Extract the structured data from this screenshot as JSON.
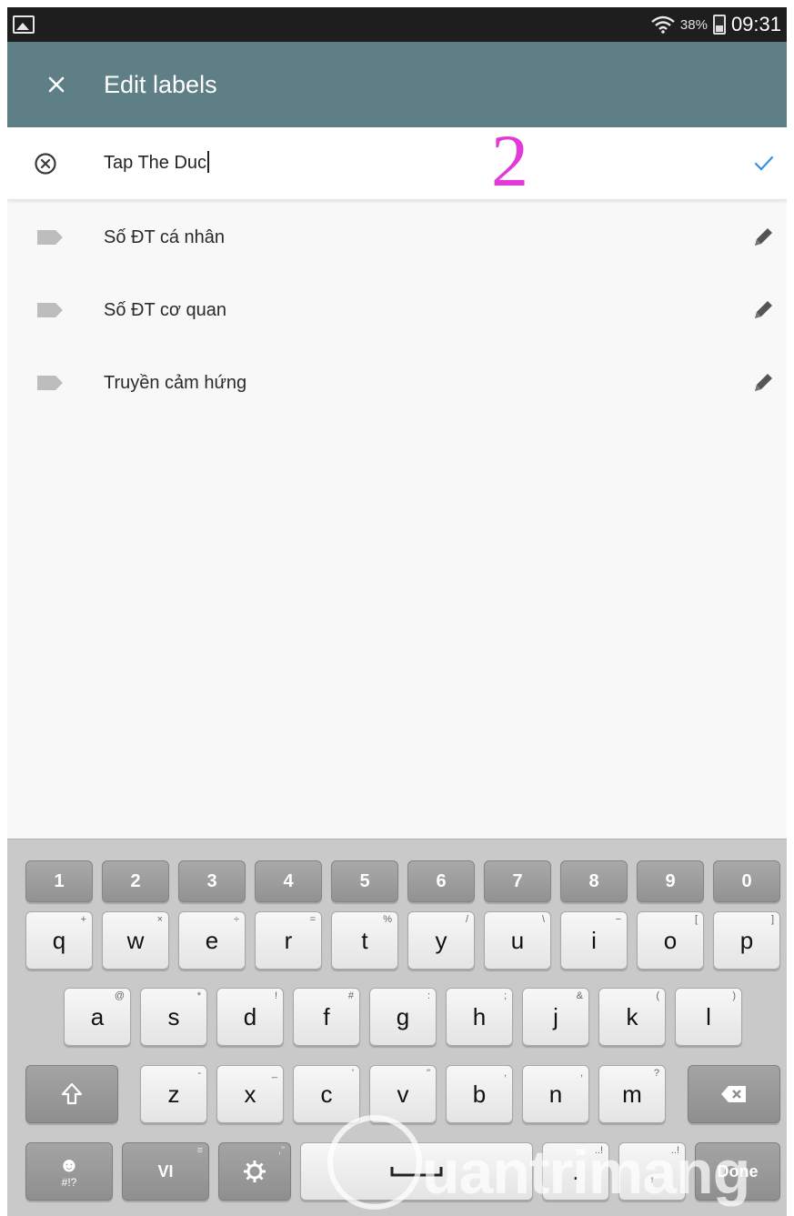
{
  "status_bar": {
    "left_icon": "gallery-icon",
    "wifi_icon": "wifi-icon",
    "battery_percent": "38%",
    "battery_icon": "battery-charging-icon",
    "time": "09:31"
  },
  "app_bar": {
    "close_icon": "close-icon",
    "title": "Edit labels",
    "background": "#5f7f87"
  },
  "edit_row": {
    "clear_icon": "clear-circle-icon",
    "value": "Tap The Duc",
    "confirm_icon": "check-icon",
    "confirm_color": "#3b8de0"
  },
  "annotation": {
    "text": "2",
    "color": "#e23ad8"
  },
  "labels": [
    {
      "icon": "label-tag-icon",
      "name": "Số ĐT cá nhân",
      "action_icon": "edit-pencil-icon"
    },
    {
      "icon": "label-tag-icon",
      "name": "Số ĐT cơ quan",
      "action_icon": "edit-pencil-icon"
    },
    {
      "icon": "label-tag-icon",
      "name": "Truyền cảm hứng",
      "action_icon": "edit-pencil-icon"
    }
  ],
  "keyboard": {
    "number_row": [
      "1",
      "2",
      "3",
      "4",
      "5",
      "6",
      "7",
      "8",
      "9",
      "0"
    ],
    "row1": [
      {
        "key": "q",
        "alt": "+"
      },
      {
        "key": "w",
        "alt": "×"
      },
      {
        "key": "e",
        "alt": "÷"
      },
      {
        "key": "r",
        "alt": "="
      },
      {
        "key": "t",
        "alt": "%"
      },
      {
        "key": "y",
        "alt": "/"
      },
      {
        "key": "u",
        "alt": "\\"
      },
      {
        "key": "i",
        "alt": "−"
      },
      {
        "key": "o",
        "alt": "["
      },
      {
        "key": "p",
        "alt": "]"
      }
    ],
    "row2": [
      {
        "key": "a",
        "alt": "@"
      },
      {
        "key": "s",
        "alt": "*"
      },
      {
        "key": "d",
        "alt": "!"
      },
      {
        "key": "f",
        "alt": "#"
      },
      {
        "key": "g",
        "alt": ":"
      },
      {
        "key": "h",
        "alt": ";"
      },
      {
        "key": "j",
        "alt": "&"
      },
      {
        "key": "k",
        "alt": "("
      },
      {
        "key": "l",
        "alt": ")"
      }
    ],
    "row3": [
      {
        "key": "z",
        "alt": "-"
      },
      {
        "key": "x",
        "alt": "_"
      },
      {
        "key": "c",
        "alt": "'"
      },
      {
        "key": "v",
        "alt": "\""
      },
      {
        "key": "b",
        "alt": ","
      },
      {
        "key": "n",
        "alt": ","
      },
      {
        "key": "m",
        "alt": "?"
      }
    ],
    "shift_icon": "shift-icon",
    "backspace_icon": "backspace-icon",
    "emoji_label": "#!?",
    "emoji_icon": "emoji-icon",
    "language": "VI",
    "settings_icon": "settings-gear-icon",
    "space_icon": "space-icon",
    "period": ".",
    "comma": ",",
    "done": "Done"
  },
  "watermark": "uantrimang"
}
